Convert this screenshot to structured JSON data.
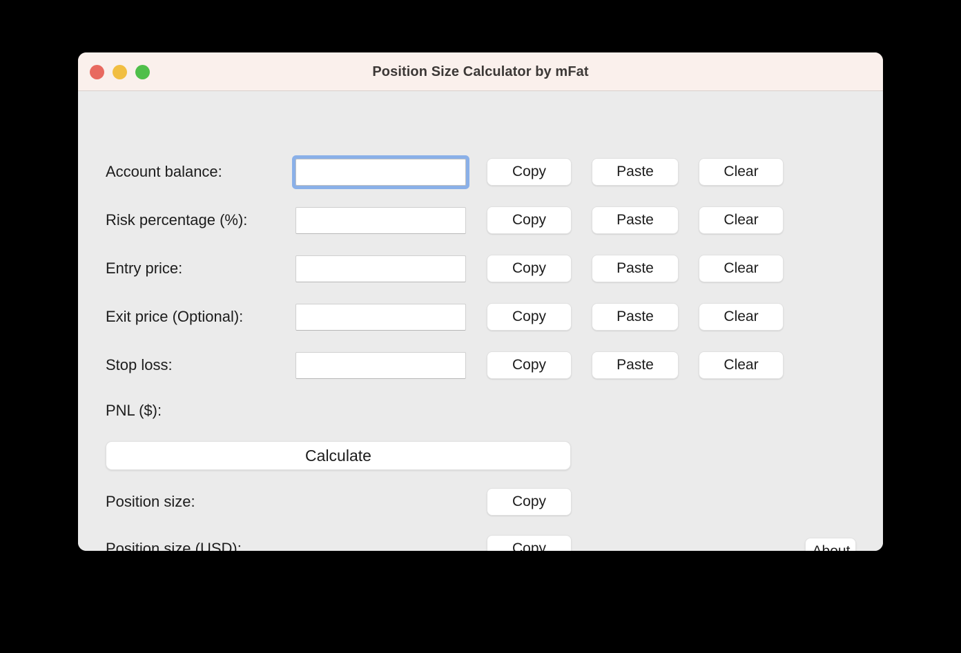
{
  "window": {
    "title": "Position Size Calculator by mFat",
    "traffic_lights": [
      {
        "name": "close",
        "color": "#e8695f"
      },
      {
        "name": "minimize",
        "color": "#f1be42"
      },
      {
        "name": "zoom",
        "color": "#4fbf4a"
      }
    ]
  },
  "colors": {
    "titlebar_bg": "#faf0ec",
    "body_bg": "#ebebeb",
    "focus_ring": "#8ab0e8",
    "text": "#1c1c1c",
    "button_bg": "#ffffff"
  },
  "buttons": {
    "copy": "Copy",
    "paste": "Paste",
    "clear": "Clear",
    "calculate": "Calculate",
    "about": "About"
  },
  "form": {
    "rows": [
      {
        "label": "Account balance:",
        "value": "",
        "placeholder": "",
        "focused": true,
        "has_input": true,
        "actions": [
          "Copy",
          "Paste",
          "Clear"
        ]
      },
      {
        "label": "Risk percentage (%):",
        "value": "",
        "placeholder": "",
        "focused": false,
        "has_input": true,
        "actions": [
          "Copy",
          "Paste",
          "Clear"
        ]
      },
      {
        "label": "Entry price:",
        "value": "",
        "placeholder": "",
        "focused": false,
        "has_input": true,
        "actions": [
          "Copy",
          "Paste",
          "Clear"
        ]
      },
      {
        "label": "Exit price (Optional):",
        "value": "",
        "placeholder": "",
        "focused": false,
        "has_input": true,
        "actions": [
          "Copy",
          "Paste",
          "Clear"
        ]
      },
      {
        "label": "Stop loss:",
        "value": "",
        "placeholder": "",
        "focused": false,
        "has_input": true,
        "actions": [
          "Copy",
          "Paste",
          "Clear"
        ]
      }
    ],
    "pnl": {
      "label": "PNL ($):",
      "value": ""
    },
    "results": [
      {
        "label": "Position size:",
        "value": "",
        "action": "Copy"
      },
      {
        "label": "Position size (USD):",
        "value": "",
        "action": "Copy"
      }
    ]
  }
}
